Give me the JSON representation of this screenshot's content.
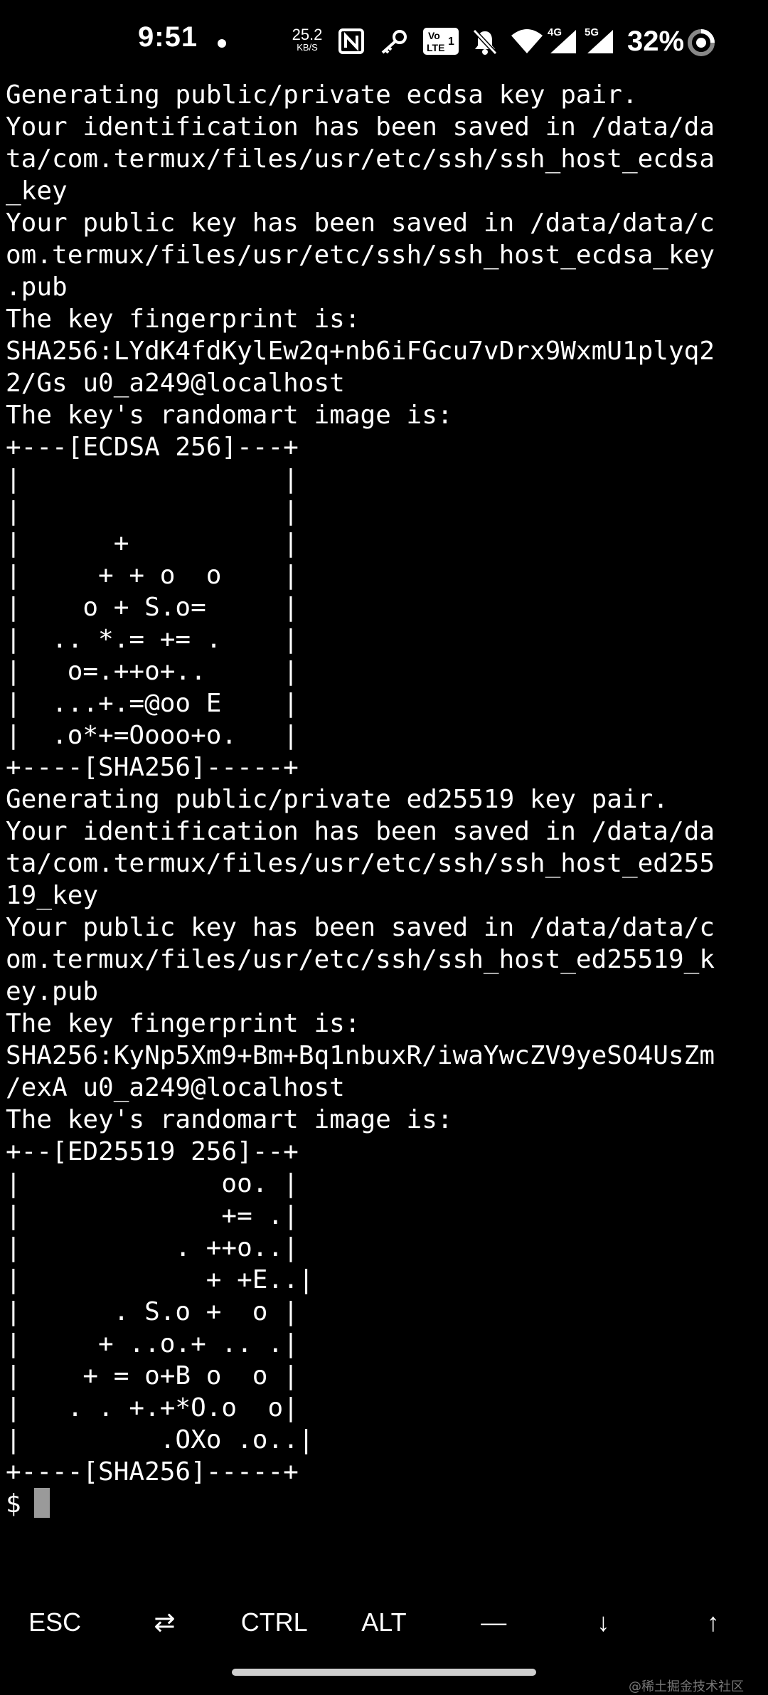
{
  "status_bar": {
    "time": "9:51",
    "net_speed_value": "25.2",
    "net_speed_unit": "KB/S",
    "battery_percent": "32%",
    "icons": [
      "notification-dot-icon",
      "nfc-icon",
      "key-icon",
      "volte-icon",
      "mute-icon",
      "wifi-icon",
      "signal-4g-icon",
      "signal-5g-icon",
      "battery-ring-icon"
    ]
  },
  "terminal": {
    "lines": [
      "Generating public/private ecdsa key pair.",
      "Your identification has been saved in /data/da",
      "ta/com.termux/files/usr/etc/ssh/ssh_host_ecdsa",
      "_key",
      "Your public key has been saved in /data/data/c",
      "om.termux/files/usr/etc/ssh/ssh_host_ecdsa_key",
      ".pub",
      "The key fingerprint is:",
      "SHA256:LYdK4fdKylEw2q+nb6iFGcu7vDrx9WxmU1plyq2",
      "2/Gs u0_a249@localhost",
      "The key's randomart image is:",
      "+---[ECDSA 256]---+",
      "|                 |",
      "|                 |",
      "|      +          |",
      "|     + + o  o    |",
      "|    o + S.o=     |",
      "|  .. *.= += .    |",
      "|   o=.++o+..     |",
      "|  ...+.=@oo E    |",
      "|  .o*+=Oooo+o.   |",
      "+----[SHA256]-----+",
      "Generating public/private ed25519 key pair.",
      "Your identification has been saved in /data/da",
      "ta/com.termux/files/usr/etc/ssh/ssh_host_ed255",
      "19_key",
      "Your public key has been saved in /data/data/c",
      "om.termux/files/usr/etc/ssh/ssh_host_ed25519_k",
      "ey.pub",
      "The key fingerprint is:",
      "SHA256:KyNp5Xm9+Bm+Bq1nbuxR/iwaYwcZV9yeSO4UsZm",
      "/exA u0_a249@localhost",
      "The key's randomart image is:",
      "+--[ED25519 256]--+",
      "|             oo. |",
      "|             += .|",
      "|          . ++o..|",
      "|            + +E..|",
      "|      . S.o +  o |",
      "|     + ..o.+ .. .|",
      "|    + = o+B o  o |",
      "|   . . +.+*O.o  o|",
      "|         .OXo .o..|",
      "+----[SHA256]-----+"
    ],
    "prompt": "$"
  },
  "extra_keys": [
    {
      "label": "ESC",
      "name": "key-esc"
    },
    {
      "label": "⇄",
      "name": "key-tab"
    },
    {
      "label": "CTRL",
      "name": "key-ctrl"
    },
    {
      "label": "ALT",
      "name": "key-alt"
    },
    {
      "label": "—",
      "name": "key-dash"
    },
    {
      "label": "↓",
      "name": "key-arrow-down"
    },
    {
      "label": "↑",
      "name": "key-arrow-up"
    }
  ],
  "watermark": "@稀土掘金技术社区"
}
